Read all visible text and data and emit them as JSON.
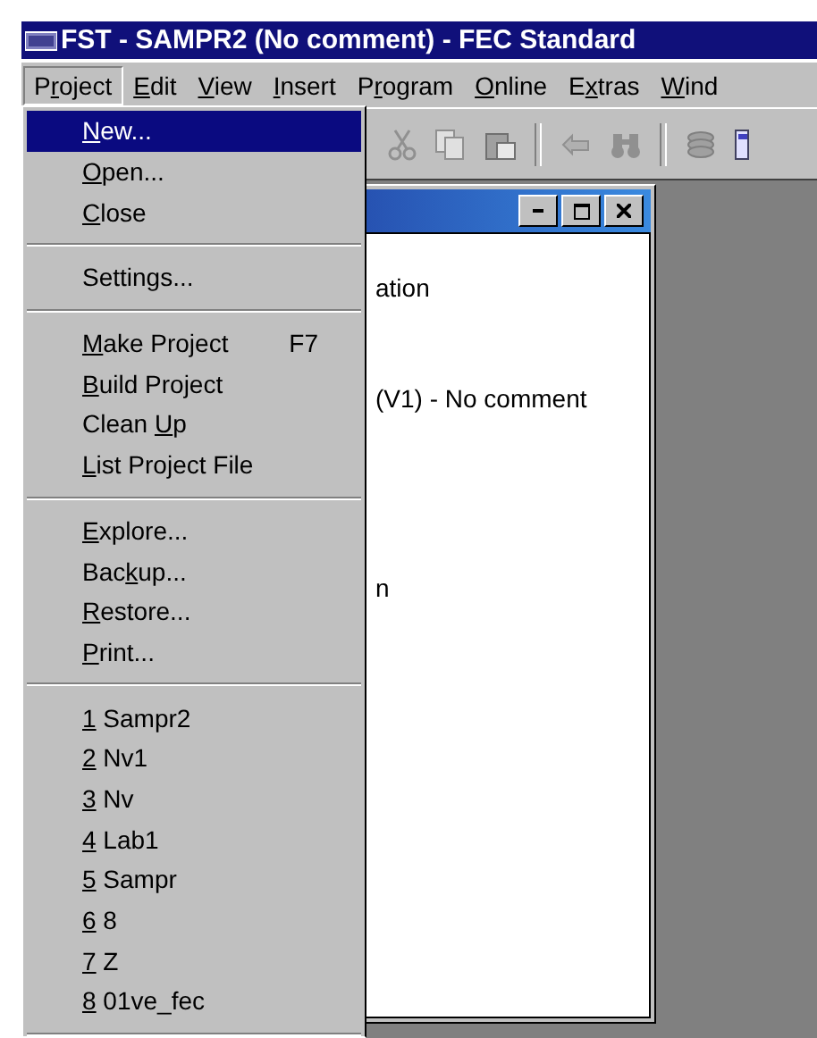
{
  "window": {
    "title": "FST - SAMPR2 (No comment) - FEC Standard"
  },
  "menu_bar": [
    {
      "before": "P",
      "key": "r",
      "after": "oject",
      "selected": true
    },
    {
      "key": "E",
      "after": "dit",
      "selected": false
    },
    {
      "key": "V",
      "after": "iew",
      "selected": false
    },
    {
      "key": "I",
      "after": "nsert",
      "selected": false
    },
    {
      "before": "P",
      "key": "r",
      "after": "ogram",
      "selected": false
    },
    {
      "key": "O",
      "after": "nline",
      "selected": false
    },
    {
      "before": "E",
      "key": "x",
      "after": "tras",
      "selected": false
    },
    {
      "key": "W",
      "after": "ind",
      "selected": false
    }
  ],
  "child_window": {
    "lines": [
      "ation",
      "(V1) - No comment",
      "n"
    ]
  },
  "project_menu": {
    "sections": [
      [
        {
          "key": "N",
          "after": "ew...",
          "selected": true
        },
        {
          "key": "O",
          "after": "pen...",
          "selected": false
        },
        {
          "key": "C",
          "after": "lose",
          "selected": false
        }
      ],
      [
        {
          "before": "Settings...",
          "selected": false
        }
      ],
      [
        {
          "key": "M",
          "after": "ake Project",
          "shortcut": "F7",
          "selected": false
        },
        {
          "key": "B",
          "after": "uild Project",
          "selected": false
        },
        {
          "before": "Clean ",
          "key": "U",
          "after": "p",
          "selected": false
        },
        {
          "key": "L",
          "after": "ist Project File",
          "selected": false
        }
      ],
      [
        {
          "key": "E",
          "after": "xplore...",
          "selected": false
        },
        {
          "before": "Bac",
          "key": "k",
          "after": "up...",
          "selected": false
        },
        {
          "key": "R",
          "after": "estore...",
          "selected": false
        },
        {
          "key": "P",
          "after": "rint...",
          "selected": false
        }
      ],
      [
        {
          "key": "1",
          "after": " Sampr2",
          "selected": false
        },
        {
          "key": "2",
          "after": " Nv1",
          "selected": false
        },
        {
          "key": "3",
          "after": " Nv",
          "selected": false
        },
        {
          "key": "4",
          "after": " Lab1",
          "selected": false
        },
        {
          "key": "5",
          "after": " Sampr",
          "selected": false
        },
        {
          "key": "6",
          "after": " 8",
          "selected": false
        },
        {
          "key": "7",
          "after": " Z",
          "selected": false
        },
        {
          "key": "8",
          "after": " 01ve_fec",
          "selected": false
        }
      ]
    ]
  }
}
